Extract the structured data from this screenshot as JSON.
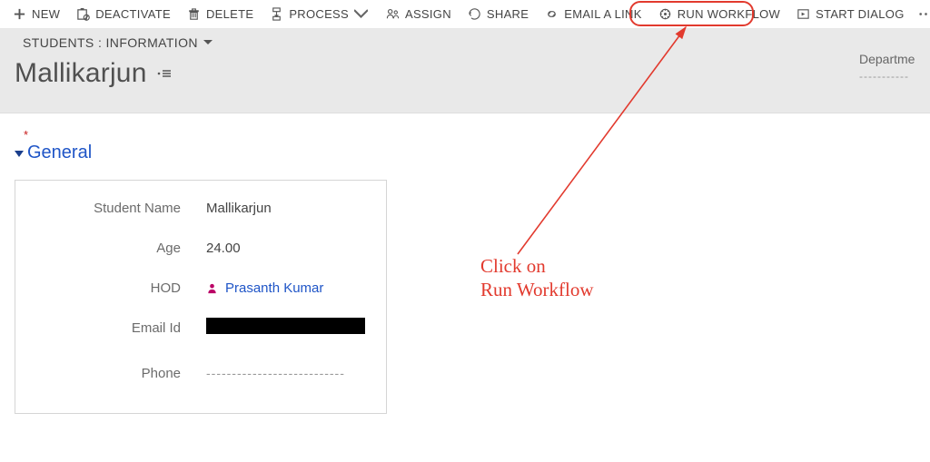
{
  "toolbar": {
    "new": "NEW",
    "deactivate": "DEACTIVATE",
    "delete": "DELETE",
    "process": "PROCESS",
    "assign": "ASSIGN",
    "share": "SHARE",
    "email_link": "EMAIL A LINK",
    "run_workflow": "RUN WORKFLOW",
    "start_dialog": "START DIALOG"
  },
  "nav": {
    "breadcrumb": "STUDENTS : INFORMATION"
  },
  "record": {
    "title": "Mallikarjun"
  },
  "sidebeta": {
    "label": "Departme",
    "value": "-----------"
  },
  "section": {
    "general": "General"
  },
  "fields": {
    "student_name_label": "Student Name",
    "student_name_value": "Mallikarjun",
    "age_label": "Age",
    "age_value": "24.00",
    "hod_label": "HOD",
    "hod_value": "Prasanth Kumar",
    "email_label": "Email Id",
    "phone_label": "Phone",
    "phone_value": "---------------------------"
  },
  "annotation": {
    "line1": "Click on",
    "line2": "Run Workflow"
  }
}
